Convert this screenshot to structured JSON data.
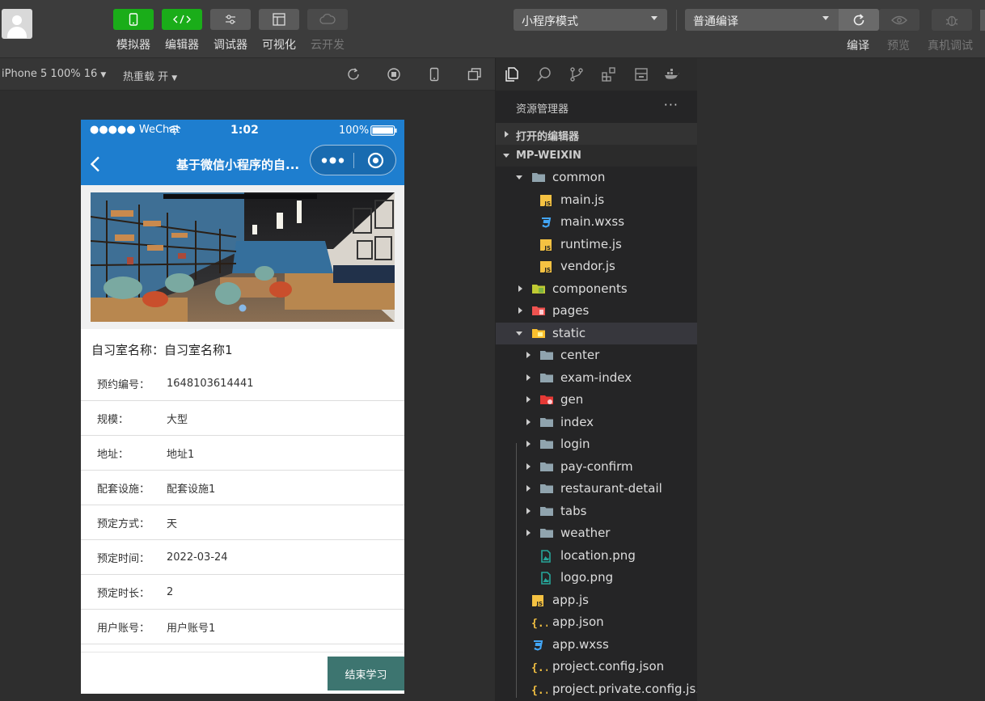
{
  "toolbar": {
    "tools": [
      {
        "label": "模拟器",
        "icon": "phone-icon"
      },
      {
        "label": "编辑器",
        "icon": "code-icon"
      },
      {
        "label": "调试器",
        "icon": "debug-sliders-icon"
      },
      {
        "label": "可视化",
        "icon": "layout-icon"
      },
      {
        "label": "云开发",
        "icon": "cloud-icon"
      }
    ],
    "mode_select": "小程序模式",
    "compile_select": "普通编译",
    "compile_label": "编译",
    "preview_label": "预览",
    "realdebug_label": "真机调试"
  },
  "simbar": {
    "device": "iPhone 5 100% 16",
    "hot_reload": "热重载 开"
  },
  "phone": {
    "carrier": "●●●●● WeChat",
    "time": "1:02",
    "battery": "100%",
    "nav_title": "基于微信小程序的自...",
    "room_title": "自习室名称：自习室名称1",
    "rows": [
      {
        "k": "预约编号：",
        "v": "1648103614441"
      },
      {
        "k": "规模：",
        "v": "大型"
      },
      {
        "k": "地址：",
        "v": "地址1"
      },
      {
        "k": "配套设施：",
        "v": "配套设施1"
      },
      {
        "k": "预定方式：",
        "v": "天"
      },
      {
        "k": "预定时间：",
        "v": "2022-03-24"
      },
      {
        "k": "预定时长：",
        "v": "2"
      },
      {
        "k": "用户账号：",
        "v": "用户账号1"
      }
    ],
    "end_button": "结束学习"
  },
  "explorer": {
    "title": "资源管理器",
    "more": "···",
    "open_editors": "打开的编辑器",
    "project": "MP-WEIXIN",
    "tree": [
      {
        "label": "common",
        "type": "folder-open",
        "depth": 1,
        "open": true
      },
      {
        "label": "main.js",
        "type": "js",
        "depth": 2
      },
      {
        "label": "main.wxss",
        "type": "css",
        "depth": 2
      },
      {
        "label": "runtime.js",
        "type": "js",
        "depth": 2
      },
      {
        "label": "vendor.js",
        "type": "js",
        "depth": 2
      },
      {
        "label": "components",
        "type": "folder-green",
        "depth": 1
      },
      {
        "label": "pages",
        "type": "folder-red",
        "depth": 1
      },
      {
        "label": "static",
        "type": "folder-open-yellow",
        "depth": 1,
        "open": true,
        "selected": true
      },
      {
        "label": "center",
        "type": "folder",
        "depth": 2
      },
      {
        "label": "exam-index",
        "type": "folder",
        "depth": 2
      },
      {
        "label": "gen",
        "type": "folder-gen",
        "depth": 2
      },
      {
        "label": "index",
        "type": "folder",
        "depth": 2
      },
      {
        "label": "login",
        "type": "folder",
        "depth": 2
      },
      {
        "label": "pay-confirm",
        "type": "folder",
        "depth": 2
      },
      {
        "label": "restaurant-detail",
        "type": "folder",
        "depth": 2
      },
      {
        "label": "tabs",
        "type": "folder",
        "depth": 2
      },
      {
        "label": "weather",
        "type": "folder",
        "depth": 2
      },
      {
        "label": "location.png",
        "type": "image",
        "depth": 2
      },
      {
        "label": "logo.png",
        "type": "image",
        "depth": 2
      },
      {
        "label": "app.js",
        "type": "js",
        "depth": 1
      },
      {
        "label": "app.json",
        "type": "json",
        "depth": 1
      },
      {
        "label": "app.wxss",
        "type": "css",
        "depth": 1
      },
      {
        "label": "project.config.json",
        "type": "json",
        "depth": 1
      },
      {
        "label": "project.private.config.js...",
        "type": "json",
        "depth": 1
      }
    ]
  }
}
